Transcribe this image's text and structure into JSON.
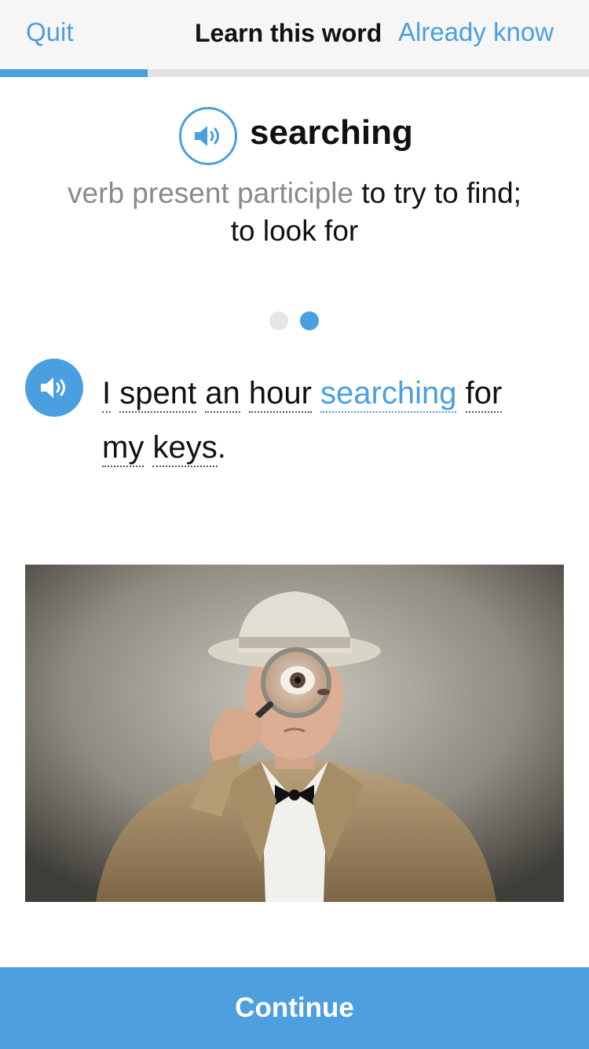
{
  "nav": {
    "quit_label": "Quit",
    "title": "Learn this word",
    "already_know_label": "Already know"
  },
  "progress": {
    "fraction": 0.25
  },
  "word": {
    "text": "searching",
    "part_of_speech": "verb present participle",
    "definition_line1": "to try to find;",
    "definition_line2": "to look for"
  },
  "pager": {
    "total": 2,
    "current": 2
  },
  "example": {
    "words": [
      {
        "text": "I",
        "highlight": false
      },
      {
        "text": "spent",
        "highlight": false
      },
      {
        "text": "an",
        "highlight": false
      },
      {
        "text": "hour",
        "highlight": false
      },
      {
        "text": "searching",
        "highlight": true
      },
      {
        "text": "for",
        "highlight": false
      },
      {
        "text": "my",
        "highlight": false
      },
      {
        "text": "keys",
        "highlight": false
      }
    ],
    "end_punctuation": "."
  },
  "footer": {
    "continue_label": "Continue"
  },
  "colors": {
    "accent": "#4a9fe0",
    "nav_background": "#f6f6f6",
    "muted_text": "#8a8a8a"
  },
  "icons": {
    "word_audio": "speaker-icon",
    "sentence_audio": "speaker-icon"
  }
}
